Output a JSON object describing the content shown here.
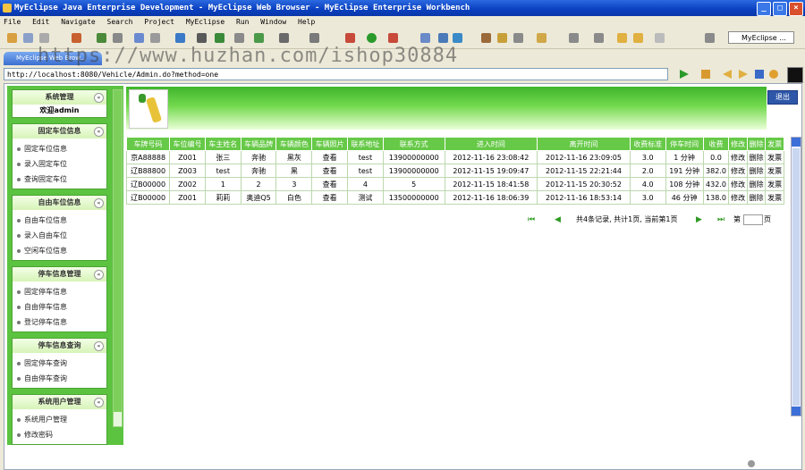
{
  "window": {
    "title": "MyEclipse Java Enterprise Development - MyEclipse Web Browser - MyEclipse Enterprise Workbench",
    "min": "_",
    "max": "□",
    "close": "×"
  },
  "menu": [
    "File",
    "Edit",
    "Navigate",
    "Search",
    "Project",
    "MyEclipse",
    "Run",
    "Window",
    "Help"
  ],
  "perspective": "MyEclipse ...",
  "tab": {
    "label": "MyEclipse Web Brow..."
  },
  "watermark": "https://www.huzhan.com/ishop30884",
  "address": {
    "url": "http://localhost:8080/Vehicle/Admin.do?method=one"
  },
  "sidebar": {
    "sections": [
      {
        "title": "系统管理",
        "welcome": "欢迎admin",
        "items": []
      },
      {
        "title": "固定车位信息",
        "items": [
          "固定车位信息",
          "录入固定车位",
          "查询固定车位"
        ]
      },
      {
        "title": "自由车位信息",
        "items": [
          "自由车位信息",
          "录入自由车位",
          "空闲车位信息"
        ]
      },
      {
        "title": "停车信息管理",
        "items": [
          "固定停车信息",
          "自由停车信息",
          "登记停车信息"
        ]
      },
      {
        "title": "停车信息查询",
        "items": [
          "固定停车查询",
          "自由停车查询"
        ]
      },
      {
        "title": "系统用户管理",
        "items": [
          "系统用户管理",
          "修改密码"
        ]
      }
    ],
    "toggle": "«"
  },
  "logout_label": "退出",
  "table": {
    "headers": [
      "车牌号码",
      "车位编号",
      "车主姓名",
      "车辆品牌",
      "车辆颜色",
      "车辆照片",
      "联系地址",
      "联系方式",
      "进入时间",
      "离开时间",
      "收费标准",
      "停车时间",
      "收费",
      "修改",
      "删除",
      "发票"
    ],
    "rows": [
      [
        "京A88888",
        "Z001",
        "张三",
        "奔驰",
        "黑灰",
        "查看",
        "test",
        "13900000000",
        "2012-11-16 23:08:42",
        "2012-11-16 23:09:05",
        "3.0",
        "1 分钟",
        "0.0",
        "修改",
        "删除",
        "发票"
      ],
      [
        "辽B88800",
        "Z003",
        "test",
        "奔驰",
        "黑",
        "查看",
        "test",
        "13900000000",
        "2012-11-15 19:09:47",
        "2012-11-15 22:21:44",
        "2.0",
        "191 分钟",
        "382.0",
        "修改",
        "删除",
        "发票"
      ],
      [
        "辽B00000",
        "Z002",
        "1",
        "2",
        "3",
        "查看",
        "4",
        "5",
        "2012-11-15 18:41:58",
        "2012-11-15 20:30:52",
        "4.0",
        "108 分钟",
        "432.0",
        "修改",
        "删除",
        "发票"
      ],
      [
        "辽B00000",
        "Z001",
        "莉莉",
        "奥迪Q5",
        "白色",
        "查看",
        "测试",
        "13500000000",
        "2012-11-16 18:06:39",
        "2012-11-16 18:53:14",
        "3.0",
        "46 分钟",
        "138.0",
        "修改",
        "删除",
        "发票"
      ]
    ]
  },
  "pager": {
    "first": "⏮",
    "prev": "◀",
    "next": "▶",
    "last": "⏭",
    "info": "共4条记录, 共计1页, 当前第1页",
    "goto_prefix": "第",
    "goto_suffix": "页"
  },
  "colors": {
    "sidebar_green": "#5cc341",
    "header_green": "#66c947",
    "title_blue": "#0a3fbf"
  }
}
